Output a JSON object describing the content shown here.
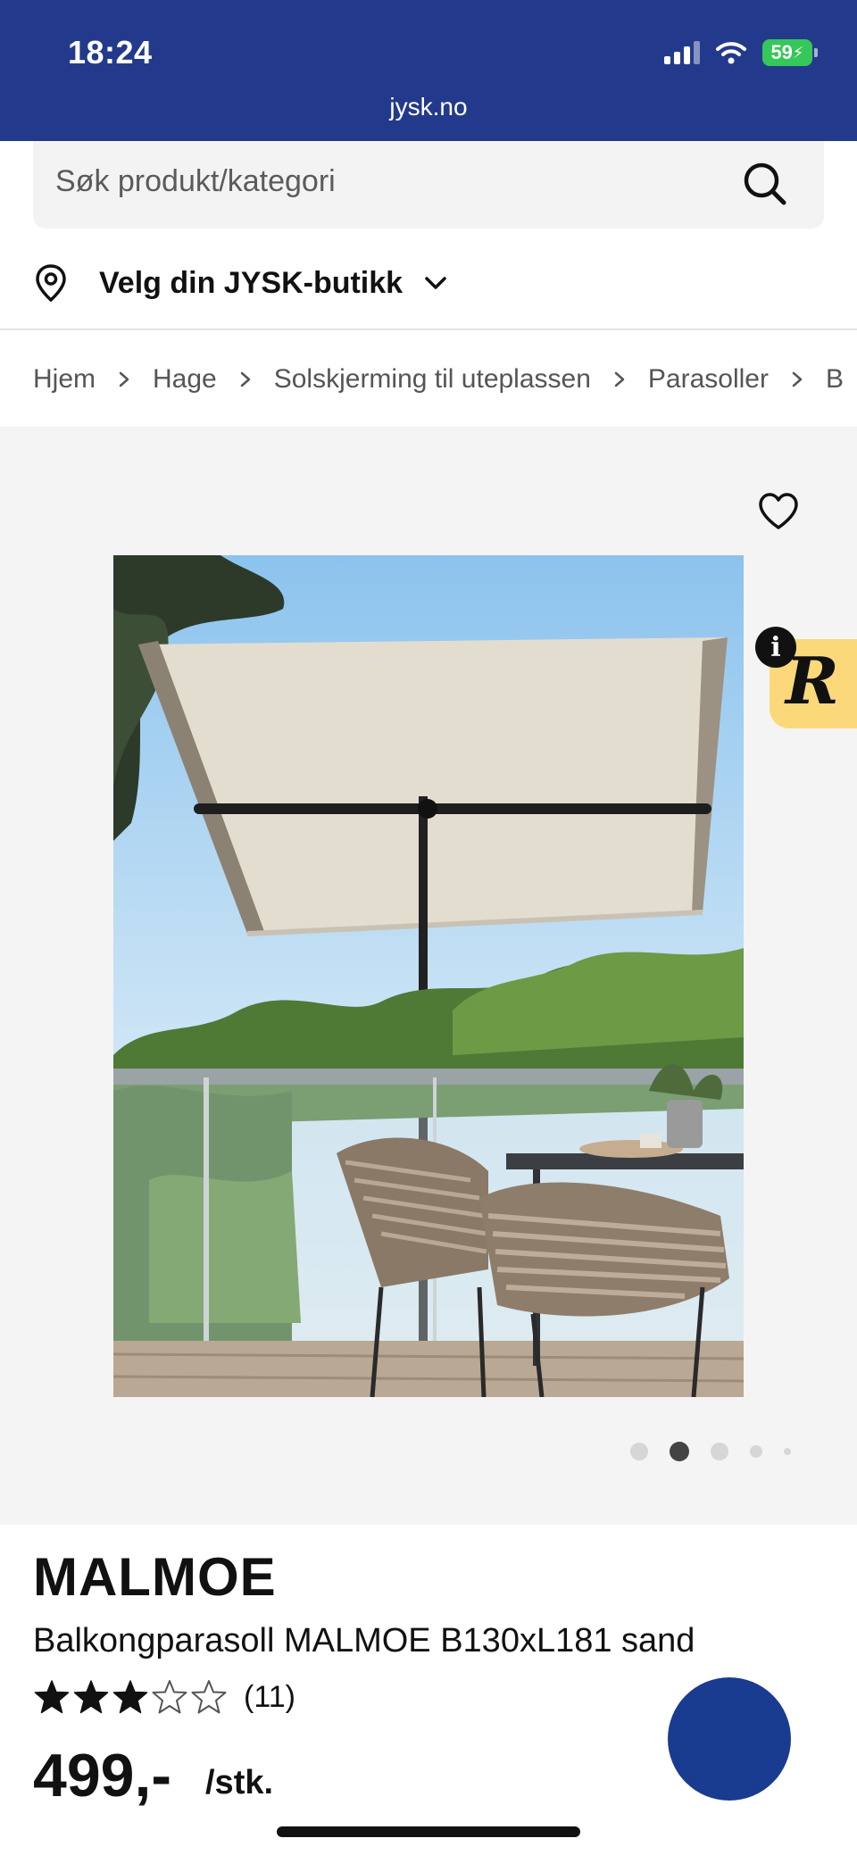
{
  "status_bar": {
    "time": "18:24",
    "battery_level": "59",
    "icons": [
      "signal-icon",
      "wifi-icon",
      "battery-icon"
    ]
  },
  "browser": {
    "url": "jysk.no"
  },
  "search": {
    "placeholder": "Søk produkt/kategori",
    "icon": "search-icon"
  },
  "store_selector": {
    "label": "Velg din JYSK-butikk",
    "icon": "location-pin-icon"
  },
  "breadcrumb": [
    "Hjem",
    "Hage",
    "Solskjerming til uteplassen",
    "Parasoller",
    "B"
  ],
  "gallery": {
    "image_count": 5,
    "active_index": 1,
    "badge_letter": "R",
    "info_letter": "i"
  },
  "product": {
    "brand": "MALMOE",
    "name": "Balkongparasoll MALMOE B130xL181 sand",
    "rating": 3,
    "rating_max": 5,
    "review_count": "(11)",
    "price": "499,-",
    "unit": "/stk."
  },
  "colors": {
    "header_blue": "#233a8c",
    "action_blue": "#193b90",
    "battery_green": "#35c759",
    "badge_yellow": "#fbd97a"
  }
}
